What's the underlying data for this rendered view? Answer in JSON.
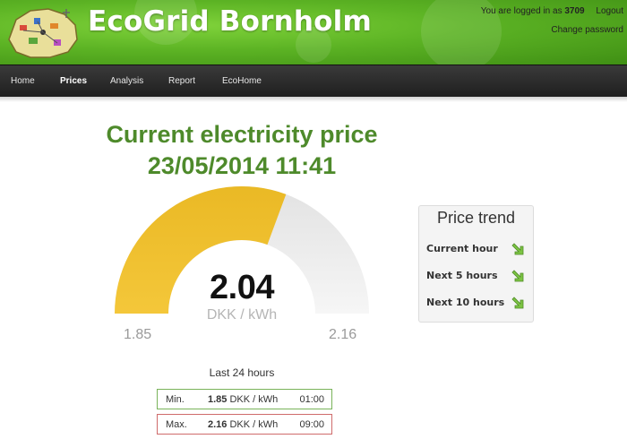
{
  "header": {
    "site_title": "EcoGrid Bornholm",
    "login_prefix": "You are logged in as",
    "user_id": "3709",
    "logout_label": "Logout",
    "change_password_label": "Change password"
  },
  "nav": {
    "items": [
      {
        "label": "Home",
        "active": false
      },
      {
        "label": "Prices",
        "active": true
      },
      {
        "label": "Analysis",
        "active": false
      },
      {
        "label": "Report",
        "active": false
      },
      {
        "label": "EcoHome",
        "active": false
      }
    ]
  },
  "price": {
    "title_line1": "Current electricity price",
    "title_line2": "23/05/2014 11:41",
    "current": "2.04",
    "unit": "DKK / kWh",
    "scale_min": "1.85",
    "scale_max": "2.16",
    "current_value": 2.04,
    "min_value": 1.85,
    "max_value": 2.16
  },
  "trend": {
    "title": "Price trend",
    "rows": [
      {
        "label": "Current hour",
        "direction": "down"
      },
      {
        "label": "Next 5 hours",
        "direction": "down"
      },
      {
        "label": "Next 10 hours",
        "direction": "down"
      }
    ]
  },
  "last24": {
    "title": "Last 24 hours",
    "min": {
      "label": "Min.",
      "value": "1.85",
      "unit": "DKK / kWh",
      "time": "01:00"
    },
    "max": {
      "label": "Max.",
      "value": "2.16",
      "unit": "DKK / kWh",
      "time": "09:00"
    }
  },
  "colors": {
    "brand_green": "#5cb324",
    "title_green": "#4e8a2b",
    "gauge_fill": "#f0c02a",
    "gauge_empty": "#ececec",
    "arrow_green": "#7cc443",
    "min_border": "#79b35a",
    "max_border": "#cf6b6b"
  }
}
